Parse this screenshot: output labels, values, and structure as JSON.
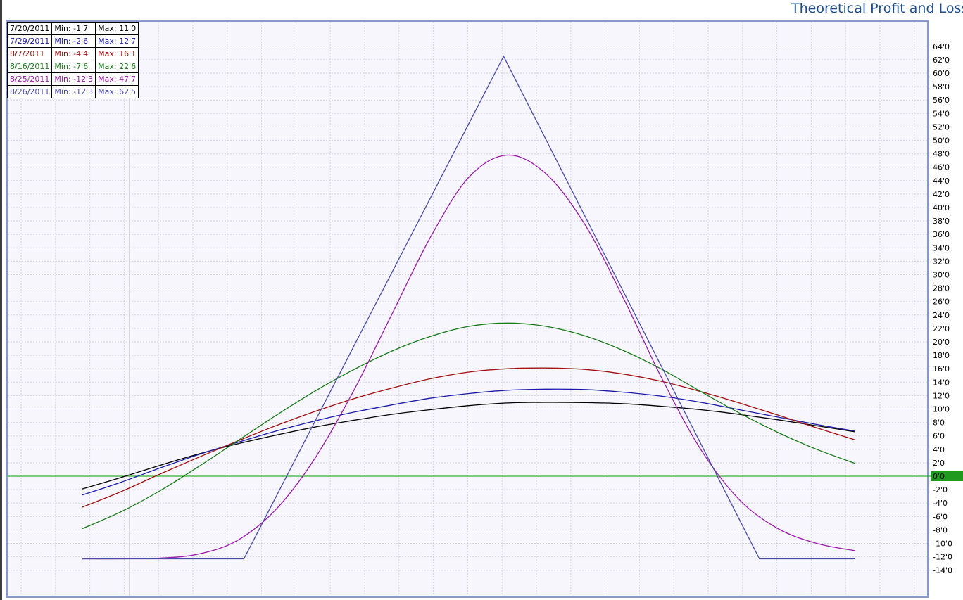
{
  "chart_data": {
    "type": "line",
    "title": "Theoretical Profit and Loss",
    "xlabel": "",
    "ylabel": "",
    "ylim": [
      -14,
      64
    ],
    "grid": true,
    "legend_position": "top-left",
    "zero_line_color": "#00a000",
    "y_ticks": [
      {
        "value": 64,
        "label": "64'0"
      },
      {
        "value": 62,
        "label": "62'0"
      },
      {
        "value": 60,
        "label": "60'0"
      },
      {
        "value": 58,
        "label": "58'0"
      },
      {
        "value": 56,
        "label": "56'0"
      },
      {
        "value": 54,
        "label": "54'0"
      },
      {
        "value": 52,
        "label": "52'0"
      },
      {
        "value": 50,
        "label": "50'0"
      },
      {
        "value": 48,
        "label": "48'0"
      },
      {
        "value": 46,
        "label": "46'0"
      },
      {
        "value": 44,
        "label": "44'0"
      },
      {
        "value": 42,
        "label": "42'0"
      },
      {
        "value": 40,
        "label": "40'0"
      },
      {
        "value": 38,
        "label": "38'0"
      },
      {
        "value": 36,
        "label": "36'0"
      },
      {
        "value": 34,
        "label": "34'0"
      },
      {
        "value": 32,
        "label": "32'0"
      },
      {
        "value": 30,
        "label": "30'0"
      },
      {
        "value": 28,
        "label": "28'0"
      },
      {
        "value": 26,
        "label": "26'0"
      },
      {
        "value": 24,
        "label": "24'0"
      },
      {
        "value": 22,
        "label": "22'0"
      },
      {
        "value": 20,
        "label": "20'0"
      },
      {
        "value": 18,
        "label": "18'0"
      },
      {
        "value": 16,
        "label": "16'0"
      },
      {
        "value": 14,
        "label": "14'0"
      },
      {
        "value": 12,
        "label": "12'0"
      },
      {
        "value": 10,
        "label": "10'0"
      },
      {
        "value": 8,
        "label": "8'0"
      },
      {
        "value": 6,
        "label": "6'0"
      },
      {
        "value": 4,
        "label": "4'0"
      },
      {
        "value": 2,
        "label": "2'0"
      },
      {
        "value": 0,
        "label": "0'0"
      },
      {
        "value": -2,
        "label": "-2'0"
      },
      {
        "value": -4,
        "label": "-4'0"
      },
      {
        "value": -6,
        "label": "-6'0"
      },
      {
        "value": -8,
        "label": "-8'0"
      },
      {
        "value": -10,
        "label": "-10'0"
      },
      {
        "value": -12,
        "label": "-12'0"
      },
      {
        "value": -14,
        "label": "-14'0"
      }
    ],
    "series": [
      {
        "name": "7/20/2011",
        "min_label": "Min: -1'7",
        "max_label": "Max: 11'0",
        "color": "#000000",
        "x": [
          0,
          0.05,
          0.1,
          0.15,
          0.2,
          0.25,
          0.3,
          0.35,
          0.4,
          0.45,
          0.5,
          0.55,
          0.6,
          0.65,
          0.7,
          0.75,
          0.8,
          0.85,
          0.9,
          0.95,
          1.0
        ],
        "values": [
          -1.9,
          -0.2,
          1.6,
          3.3,
          4.8,
          6.1,
          7.3,
          8.3,
          9.2,
          9.9,
          10.5,
          10.9,
          11.0,
          10.95,
          10.8,
          10.4,
          9.9,
          9.2,
          8.4,
          7.5,
          6.6
        ]
      },
      {
        "name": "7/29/2011",
        "min_label": "Min: -2'6",
        "max_label": "Max: 12'7",
        "color": "#1a1aa8",
        "x": [
          0,
          0.05,
          0.1,
          0.15,
          0.2,
          0.25,
          0.3,
          0.35,
          0.4,
          0.45,
          0.5,
          0.55,
          0.6,
          0.65,
          0.7,
          0.75,
          0.8,
          0.85,
          0.9,
          0.95,
          1.0
        ],
        "values": [
          -2.8,
          -0.9,
          1.2,
          3.2,
          5.0,
          6.7,
          8.2,
          9.5,
          10.6,
          11.6,
          12.3,
          12.8,
          12.95,
          12.9,
          12.5,
          11.9,
          11.0,
          9.9,
          8.8,
          7.7,
          6.7
        ]
      },
      {
        "name": "8/7/2011",
        "min_label": "Min: -4'4",
        "max_label": "Max: 16'1",
        "color": "#a01010",
        "x": [
          0,
          0.05,
          0.1,
          0.15,
          0.2,
          0.25,
          0.3,
          0.35,
          0.4,
          0.45,
          0.5,
          0.55,
          0.6,
          0.65,
          0.7,
          0.75,
          0.8,
          0.85,
          0.9,
          0.95,
          1.0
        ],
        "values": [
          -4.6,
          -2.3,
          0.3,
          2.8,
          5.2,
          7.5,
          9.6,
          11.5,
          13.1,
          14.5,
          15.5,
          16.0,
          16.1,
          15.9,
          15.2,
          14.1,
          12.6,
          10.9,
          9.1,
          7.2,
          5.4
        ]
      },
      {
        "name": "8/16/2011",
        "min_label": "Min: -7'6",
        "max_label": "Max: 22'6",
        "color": "#1a7a1a",
        "x": [
          0,
          0.05,
          0.1,
          0.15,
          0.2,
          0.25,
          0.3,
          0.35,
          0.4,
          0.45,
          0.5,
          0.55,
          0.6,
          0.65,
          0.7,
          0.75,
          0.8,
          0.85,
          0.9,
          0.95,
          1.0
        ],
        "values": [
          -7.8,
          -5.3,
          -2.2,
          1.4,
          5.2,
          9.0,
          12.6,
          15.8,
          18.6,
          20.8,
          22.3,
          22.8,
          22.3,
          20.9,
          18.7,
          15.9,
          12.6,
          9.4,
          6.5,
          4.0,
          1.9
        ]
      },
      {
        "name": "8/25/2011",
        "min_label": "Min: -12'3",
        "max_label": "Max: 47'7",
        "color": "#9a1aa8",
        "x": [
          0,
          0.05,
          0.1,
          0.15,
          0.2,
          0.25,
          0.3,
          0.35,
          0.4,
          0.45,
          0.5,
          0.55,
          0.6,
          0.65,
          0.7,
          0.75,
          0.8,
          0.85,
          0.9,
          0.95,
          1.0
        ],
        "values": [
          -12.3,
          -12.3,
          -12.2,
          -11.6,
          -9.6,
          -5.0,
          2.5,
          12.5,
          24.0,
          35.5,
          44.5,
          47.8,
          45.0,
          37.5,
          26.5,
          14.5,
          4.0,
          -3.5,
          -7.8,
          -10.0,
          -11.1
        ]
      },
      {
        "name": "8/26/2011",
        "min_label": "Min: -12'3",
        "max_label": "Max: 62'5",
        "color": "#4a4aa8",
        "x": [
          0,
          0.209,
          0.545,
          0.876,
          1.0
        ],
        "values": [
          -12.3,
          -12.3,
          62.5,
          -12.3,
          -12.3
        ]
      }
    ]
  }
}
